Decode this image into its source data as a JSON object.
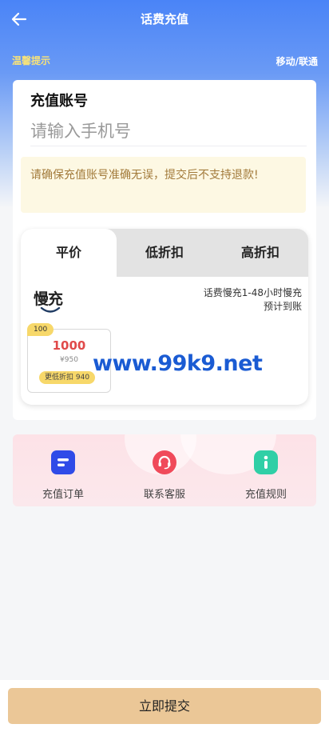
{
  "header": {
    "title": "话费充值"
  },
  "notice": {
    "tip_label": "温馨提示",
    "carrier_label": "移动/联通"
  },
  "account": {
    "label": "充值账号",
    "placeholder": "请输入手机号",
    "warning": "请确保充值账号准确无误，提交后不支持退款!"
  },
  "tabs": [
    {
      "label": "平价",
      "active": true
    },
    {
      "label": "低折扣",
      "active": false
    },
    {
      "label": "高折扣",
      "active": false
    }
  ],
  "product": {
    "brand": "慢充",
    "note_line1": "话费慢充1-48小时慢充",
    "note_line2": "预计到账",
    "package": {
      "badge": "100",
      "value": "1000",
      "price": "¥950",
      "discount": "更低折扣 940"
    }
  },
  "watermark": "www.99k9.net",
  "services": [
    {
      "label": "充值订单",
      "icon": "order-icon",
      "color": "#2f4be8"
    },
    {
      "label": "联系客服",
      "icon": "headset-icon",
      "color": "#f04a5a"
    },
    {
      "label": "充值规则",
      "icon": "info-icon",
      "color": "#2fcfa6"
    }
  ],
  "submit_label": "立即提交",
  "colors": {
    "header_blue": "#4a84f7",
    "tip_yellow": "#f7e27a",
    "submit": "#ebc797",
    "price_red": "#e04a4a"
  }
}
